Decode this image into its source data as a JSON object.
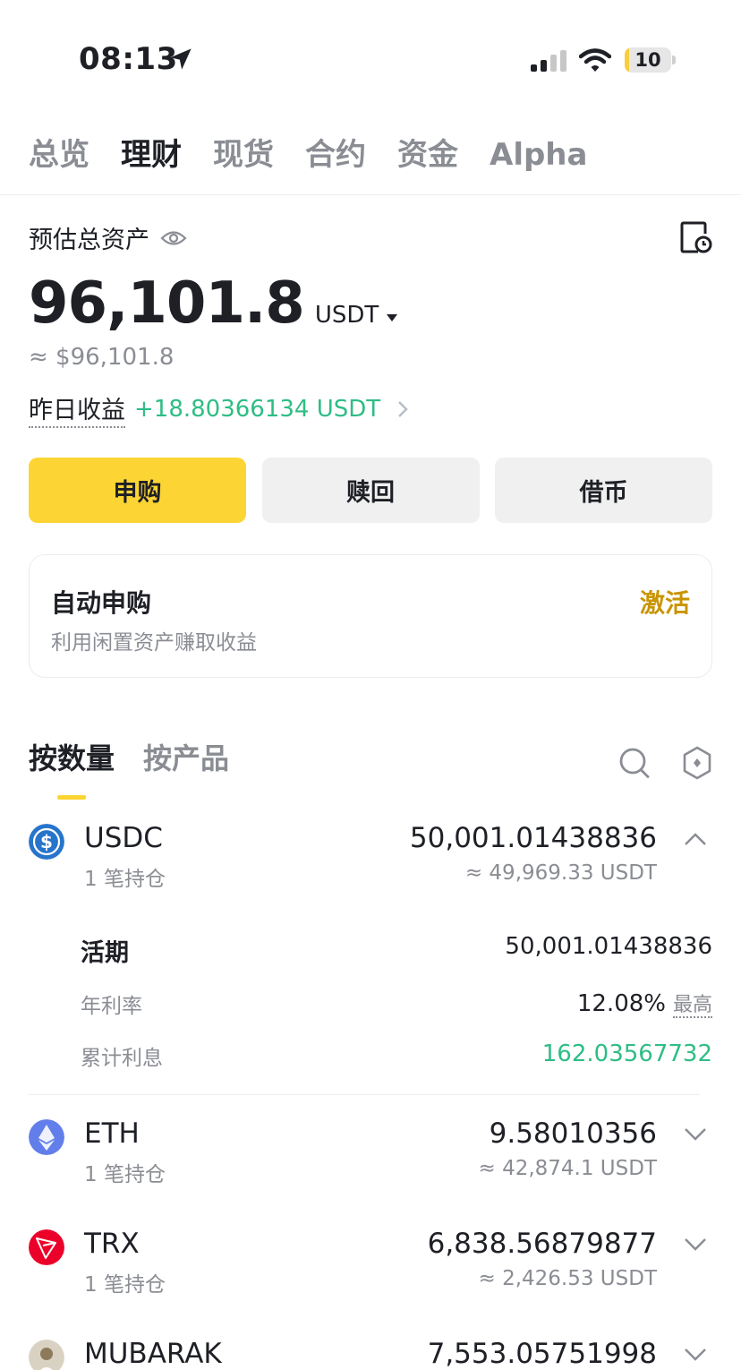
{
  "status_bar": {
    "time": "08:13",
    "battery": "10",
    "battery_level": 0.1
  },
  "tabs": [
    {
      "label": "总览",
      "active": false
    },
    {
      "label": "理财",
      "active": true
    },
    {
      "label": "现货",
      "active": false
    },
    {
      "label": "合约",
      "active": false
    },
    {
      "label": "资金",
      "active": false
    },
    {
      "label": "Alpha",
      "active": false
    }
  ],
  "asset": {
    "label": "预估总资产",
    "total": "96,101.8",
    "unit": "USDT",
    "approx_usd": "≈ $96,101.8",
    "yesterday_label": "昨日收益",
    "yesterday_value": "+18.80366134 USDT"
  },
  "actions": {
    "subscribe": "申购",
    "redeem": "赎回",
    "borrow": "借币"
  },
  "auto_subscribe": {
    "title": "自动申购",
    "description": "利用闲置资产赚取收益",
    "activate": "激活"
  },
  "list_tabs": {
    "by_quantity": "按数量",
    "by_product": "按产品"
  },
  "assets": [
    {
      "symbol": "USDC",
      "positions": "1 笔持仓",
      "amount": "50,001.01438836",
      "usdt": "≈ 49,969.33 USDT",
      "expanded": true
    },
    {
      "symbol": "ETH",
      "positions": "1 笔持仓",
      "amount": "9.58010356",
      "usdt": "≈ 42,874.1 USDT",
      "expanded": false
    },
    {
      "symbol": "TRX",
      "positions": "1 笔持仓",
      "amount": "6,838.56879877",
      "usdt": "≈ 2,426.53 USDT",
      "expanded": false
    },
    {
      "symbol": "MUBARAK",
      "positions": "",
      "amount": "7,553.05751998",
      "usdt": "",
      "expanded": false
    }
  ],
  "detail": {
    "product": "活期",
    "product_amount": "50,001.01438836",
    "apr_label": "年利率",
    "apr_value": "12.08%",
    "apr_tag": "最高",
    "interest_label": "累计利息",
    "interest_value": "162.03567732"
  },
  "colors": {
    "accent": "#fcd535",
    "positive": "#2ebd85",
    "activate": "#c99400",
    "muted": "#8a8d93"
  },
  "icons": [
    "location-arrow-icon",
    "signal-icon",
    "wifi-icon",
    "battery-icon",
    "eye-icon",
    "history-icon",
    "caret-down-icon",
    "chevron-right-icon",
    "search-icon",
    "filter-icon",
    "usdc-coin-icon",
    "eth-coin-icon",
    "trx-coin-icon",
    "mubarak-coin-icon",
    "chevron-up-icon",
    "chevron-down-icon"
  ]
}
